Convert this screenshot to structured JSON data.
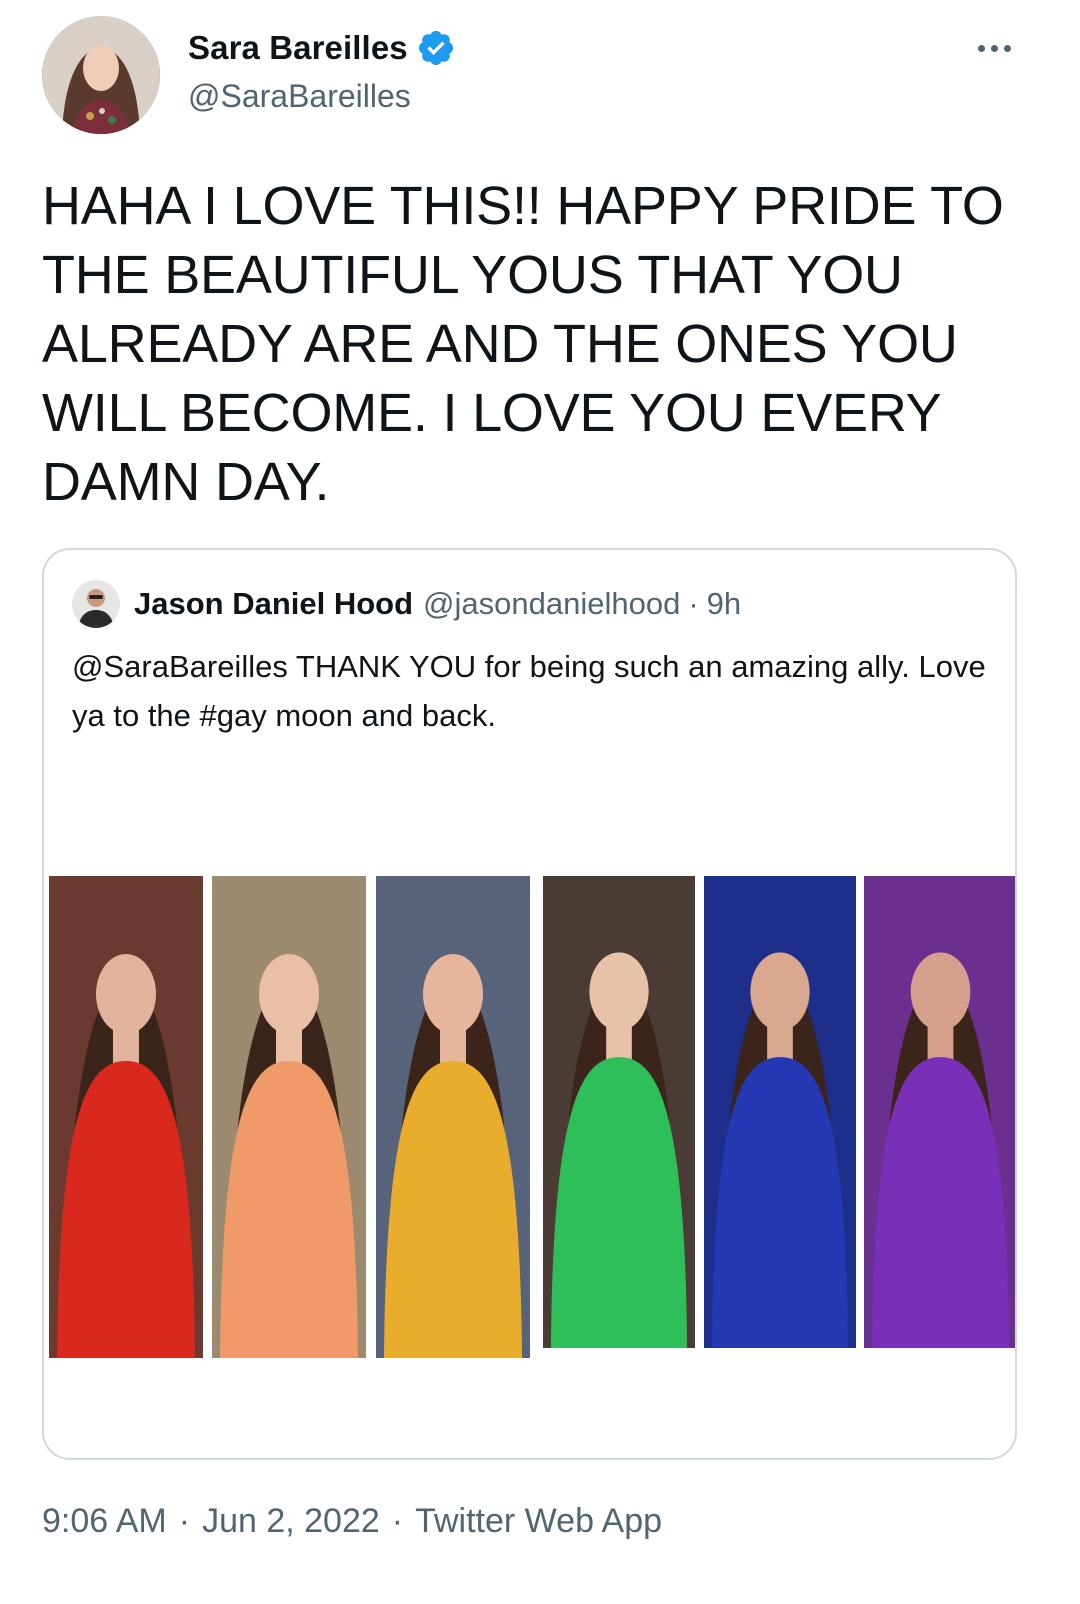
{
  "author": {
    "display_name": "Sara Bareilles",
    "handle": "@SaraBareilles",
    "verified": true
  },
  "icons": {
    "verified": "verified-badge-icon",
    "more": "more-options-icon"
  },
  "tweet": {
    "text": "HAHA I LOVE THIS!! HAPPY PRIDE TO THE BEAUTIFUL YOUS THAT YOU ALREADY ARE AND THE ONES YOU WILL BECOME. I LOVE YOU EVERY DAMN DAY."
  },
  "quoted": {
    "display_name": "Jason Daniel Hood",
    "handle": "@jasondanielhood",
    "separator": "·",
    "time": "9h",
    "text": "@SaraBareilles THANK YOU for being such an amazing ally. Love ya to the #gay moon and back."
  },
  "photo_panels": [
    {
      "name": "photo-panel-red",
      "color": "#d9281e"
    },
    {
      "name": "photo-panel-orange",
      "color": "#f09a6a"
    },
    {
      "name": "photo-panel-yellow",
      "color": "#e9ad2e"
    },
    {
      "name": "photo-panel-green",
      "color": "#2fbf5a"
    },
    {
      "name": "photo-panel-blue",
      "color": "#2438b4"
    },
    {
      "name": "photo-panel-purple",
      "color": "#7a2fb8"
    }
  ],
  "footer": {
    "time": "9:06 AM",
    "separator": "·",
    "date": "Jun 2, 2022",
    "source": "Twitter Web App"
  },
  "colors": {
    "verified_blue": "#1d9bf0",
    "secondary_text": "#536471",
    "border": "#cfd9de"
  }
}
